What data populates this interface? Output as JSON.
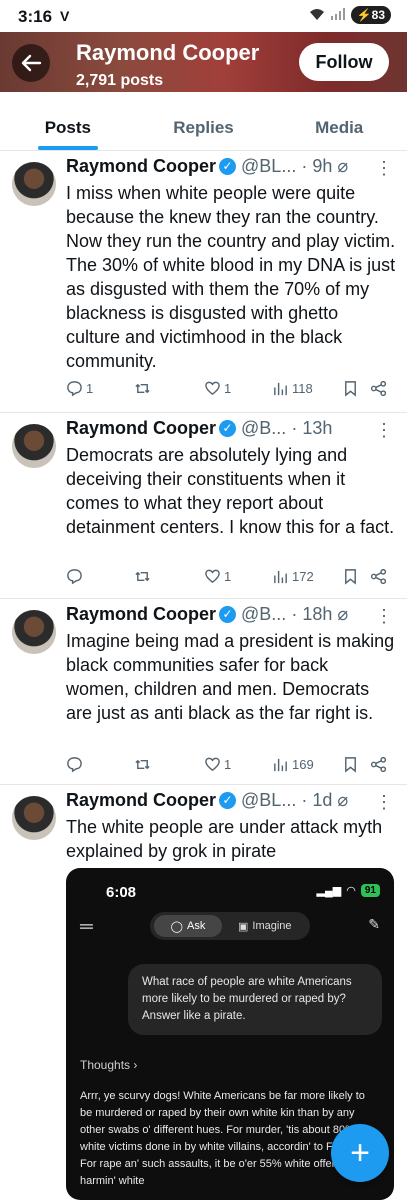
{
  "status_bar": {
    "time": "3:16",
    "left_icons": "V",
    "battery": "83"
  },
  "header": {
    "name": "Raymond Cooper",
    "posts": "2,791 posts",
    "follow_label": "Follow"
  },
  "tabs": [
    {
      "label": "Posts",
      "active": true
    },
    {
      "label": "Replies",
      "active": false
    },
    {
      "label": "Media",
      "active": false
    }
  ],
  "tweets": [
    {
      "name": "Raymond Cooper",
      "handle": "@BL...",
      "time": "9h",
      "text": "I miss when white people were quite because the knew they ran the country. Now they run the country and play victim. The 30% of white blood in my DNA is just as disgusted with them the 70% of my blackness is disgusted with ghetto culture and victimhood in the black community.",
      "replies": "1",
      "reposts": "",
      "likes": "1",
      "views": "118"
    },
    {
      "name": "Raymond Cooper",
      "handle": "@B...",
      "time": "13h",
      "text": "Democrats are absolutely lying and deceiving their constituents when it comes to what they report about detainment centers. I know this for a fact.",
      "replies": "",
      "reposts": "",
      "likes": "1",
      "views": "172"
    },
    {
      "name": "Raymond Cooper",
      "handle": "@B...",
      "time": "18h",
      "text": "Imagine being mad a president is making black communities safer for back women, children and men. Democrats are just as anti black as the far right is.",
      "replies": "",
      "reposts": "",
      "likes": "1",
      "views": "169"
    },
    {
      "name": "Raymond Cooper",
      "handle": "@BL...",
      "time": "1d",
      "text": "The white people are under attack myth explained by grok in pirate"
    }
  ],
  "media_card": {
    "time": "6:08",
    "battery": "91",
    "ask_label": "Ask",
    "imagine_label": "Imagine",
    "question": "What race of people are white Americans more likely to be murdered or raped by? Answer like a pirate.",
    "thoughts_label": "Thoughts",
    "answer": "Arrr, ye scurvy dogs! White Americans be far more likely to be murdered or raped by their own white kin than by any other swabs o' different hues. For murder, 'tis about 80% o' white victims done in by white villains, accordin' to FBI tallies. For rape an' such assaults, it be o'er 55% white offenders harmin' white"
  }
}
